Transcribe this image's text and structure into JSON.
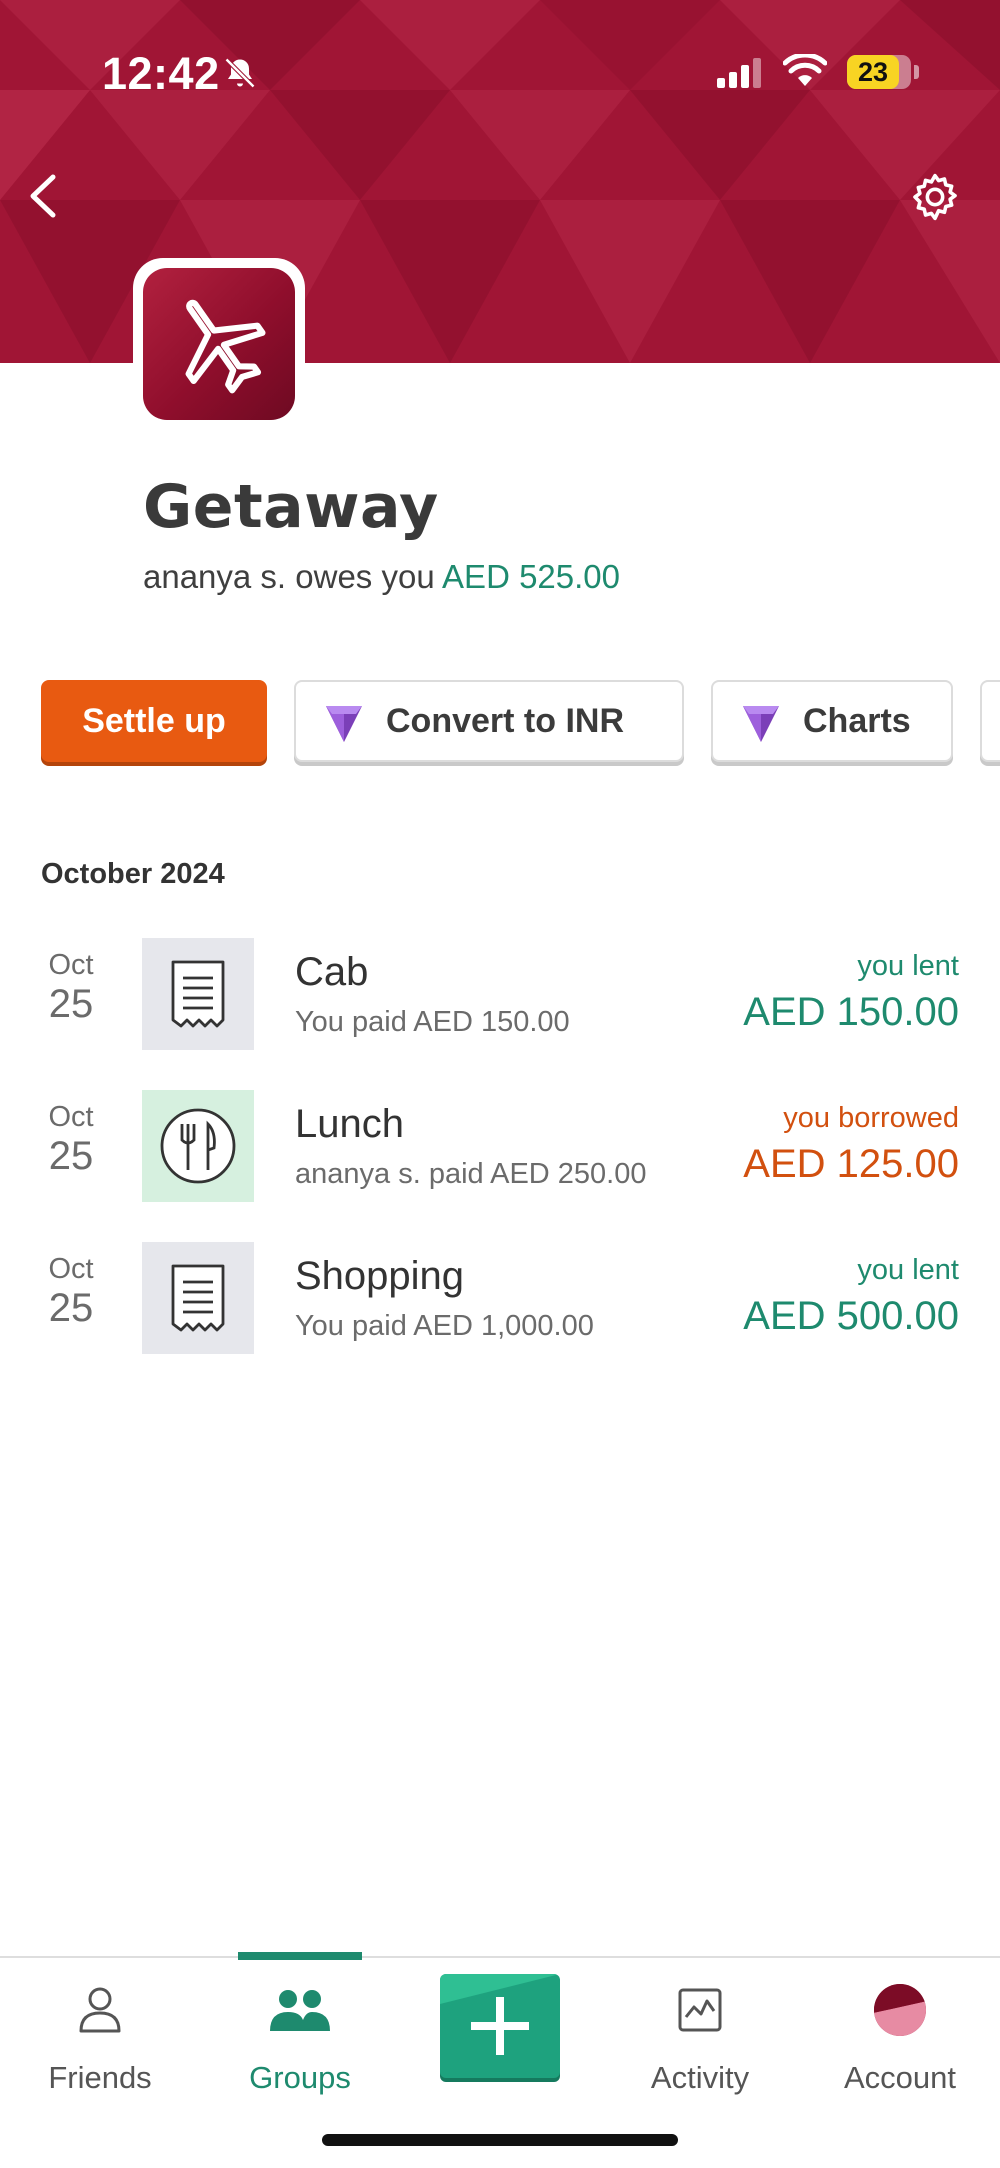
{
  "status_bar": {
    "time": "12:42",
    "battery": "23"
  },
  "header": {
    "back_icon": "chevron-left-icon",
    "settings_icon": "gear-icon",
    "group_icon": "airplane-icon",
    "banner_color": "#a01535"
  },
  "group": {
    "title": "Getaway",
    "summary_prefix": "ananya s. owes you",
    "summary_amount": "AED 525.00"
  },
  "actions": {
    "settle_up": "Settle up",
    "convert": "Convert to INR",
    "charts": "Charts"
  },
  "section": {
    "title": "October 2024"
  },
  "expenses": [
    {
      "month": "Oct",
      "day": "25",
      "icon": "receipt-icon",
      "name": "Cab",
      "detail": "You paid AED 150.00",
      "status": "you lent",
      "amount": "AED 150.00"
    },
    {
      "month": "Oct",
      "day": "25",
      "icon": "fork-knife-icon",
      "name": "Lunch",
      "detail": "ananya s. paid AED 250.00",
      "status": "you borrowed",
      "amount": "AED 125.00"
    },
    {
      "month": "Oct",
      "day": "25",
      "icon": "receipt-icon",
      "name": "Shopping",
      "detail": "You paid AED 1,000.00",
      "status": "you lent",
      "amount": "AED 500.00"
    }
  ],
  "tabs": [
    {
      "label": "Friends",
      "icon": "person-icon"
    },
    {
      "label": "Groups",
      "icon": "people-icon",
      "active": true
    },
    {
      "label": "Add expense",
      "icon": "plus-icon"
    },
    {
      "label": "Activity",
      "icon": "activity-icon"
    },
    {
      "label": "Account",
      "icon": "account-avatar-icon"
    }
  ],
  "colors": {
    "accent_green": "#1e8a6e",
    "settle_orange": "#e85a11",
    "borrowed_orange": "#d2500f",
    "banner_red": "#a01535"
  }
}
